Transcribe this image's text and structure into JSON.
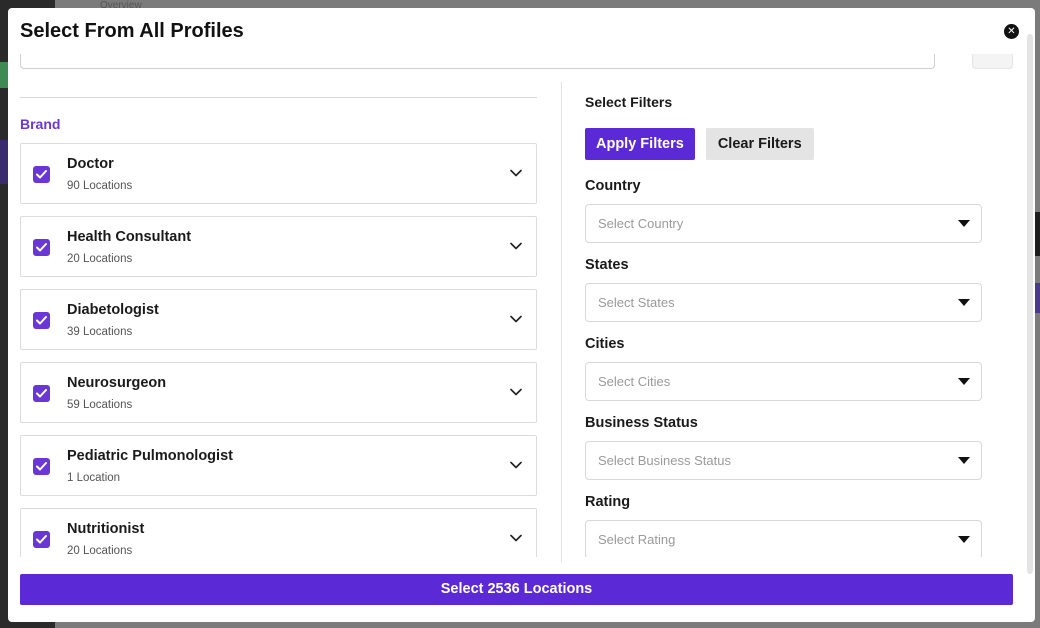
{
  "background": {
    "overview_label": "Overview"
  },
  "modal": {
    "title": "Select From All Profiles",
    "close_icon": "close-icon"
  },
  "brand": {
    "label": "Brand",
    "items": [
      {
        "name": "Doctor",
        "count": "90 Locations",
        "checked": true
      },
      {
        "name": "Health Consultant",
        "count": "20 Locations",
        "checked": true
      },
      {
        "name": "Diabetologist",
        "count": "39 Locations",
        "checked": true
      },
      {
        "name": "Neurosurgeon",
        "count": "59 Locations",
        "checked": true
      },
      {
        "name": "Pediatric Pulmonologist",
        "count": "1 Location",
        "checked": true
      },
      {
        "name": "Nutritionist",
        "count": "20 Locations",
        "checked": true
      }
    ]
  },
  "filters": {
    "title": "Select Filters",
    "apply_label": "Apply Filters",
    "clear_label": "Clear Filters",
    "groups": [
      {
        "label": "Country",
        "placeholder": "Select Country"
      },
      {
        "label": "States",
        "placeholder": "Select States"
      },
      {
        "label": "Cities",
        "placeholder": "Select Cities"
      },
      {
        "label": "Business Status",
        "placeholder": "Select Business Status"
      },
      {
        "label": "Rating",
        "placeholder": "Select Rating"
      }
    ]
  },
  "footer": {
    "select_label": "Select 2536 Locations"
  },
  "colors": {
    "accent": "#5b2ad6",
    "brand_label": "#6a37d6",
    "clear_button": "#e4e4e4"
  }
}
